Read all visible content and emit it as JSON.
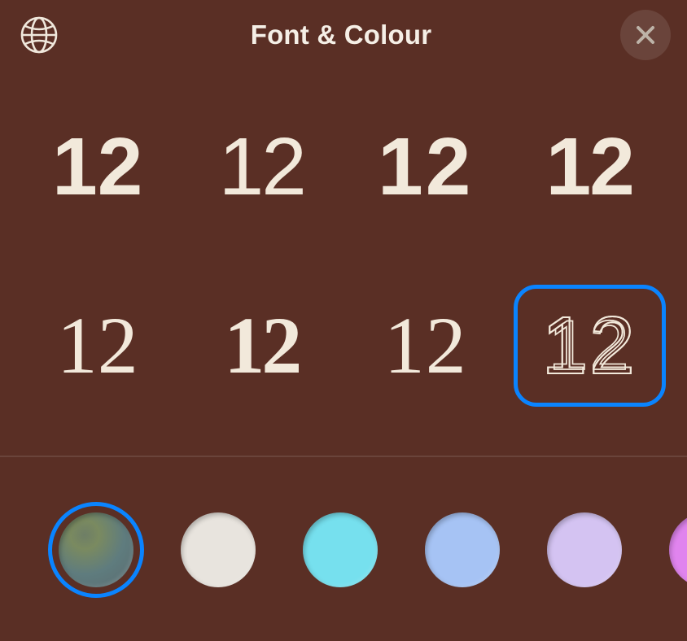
{
  "header": {
    "title": "Font & Colour"
  },
  "fonts": {
    "sample_text": "12",
    "options": [
      {
        "id": "font-1",
        "selected": false
      },
      {
        "id": "font-2",
        "selected": false
      },
      {
        "id": "font-3",
        "selected": false
      },
      {
        "id": "font-4",
        "selected": false
      },
      {
        "id": "font-5",
        "selected": false
      },
      {
        "id": "font-6",
        "selected": false
      },
      {
        "id": "font-7",
        "selected": false
      },
      {
        "id": "font-8",
        "selected": true
      }
    ]
  },
  "colors": {
    "options": [
      {
        "id": "color-dynamic",
        "hex": "gradient",
        "selected": true
      },
      {
        "id": "color-white",
        "hex": "#e8e4de",
        "selected": false
      },
      {
        "id": "color-cyan",
        "hex": "#76e0ee",
        "selected": false
      },
      {
        "id": "color-blue",
        "hex": "#a6c3f4",
        "selected": false
      },
      {
        "id": "color-lilac",
        "hex": "#d4c3f2",
        "selected": false
      },
      {
        "id": "color-magenta",
        "hex": "#e084ee",
        "selected": false
      },
      {
        "id": "color-pink",
        "hex": "#f6a4b8",
        "selected": false
      }
    ]
  }
}
